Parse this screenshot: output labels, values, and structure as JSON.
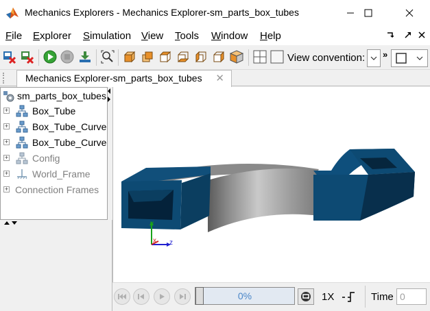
{
  "window": {
    "title": "Mechanics Explorers - Mechanics Explorer-sm_parts_box_tubes"
  },
  "menu": {
    "items": [
      {
        "label": "File",
        "mnemonic": "F",
        "rest": "ile"
      },
      {
        "label": "Explorer",
        "mnemonic": "E",
        "rest": "xplorer"
      },
      {
        "label": "Simulation",
        "mnemonic": "S",
        "rest": "imulation"
      },
      {
        "label": "View",
        "mnemonic": "V",
        "rest": "iew"
      },
      {
        "label": "Tools",
        "mnemonic": "T",
        "rest": "ools"
      },
      {
        "label": "Window",
        "mnemonic": "W",
        "rest": "indow"
      },
      {
        "label": "Help",
        "mnemonic": "H",
        "rest": "elp"
      }
    ]
  },
  "toolbar": {
    "view_convention_label": "View convention:"
  },
  "tab": {
    "label": "Mechanics Explorer-sm_parts_box_tubes",
    "close": "✕"
  },
  "tree": {
    "root": "sm_parts_box_tubes",
    "items": [
      {
        "label": "Box_Tube",
        "disabled": false
      },
      {
        "label": "Box_Tube_Curved",
        "disabled": false
      },
      {
        "label": "Box_Tube_Curved",
        "disabled": false
      },
      {
        "label": "Config",
        "disabled": true
      },
      {
        "label": "World_Frame",
        "disabled": true
      },
      {
        "label": "Connection Frames",
        "disabled": true
      }
    ]
  },
  "viewport": {
    "axes": {
      "x": "x",
      "y": "y",
      "z": "z"
    },
    "colors": {
      "tube_blue": "#0d4a73",
      "tube_blue_dark": "#082f4c",
      "curve_grey": "#8f8f8f"
    }
  },
  "playback": {
    "progress": "0%",
    "speed": "1X",
    "time_label": "Time",
    "time_value": "0"
  }
}
